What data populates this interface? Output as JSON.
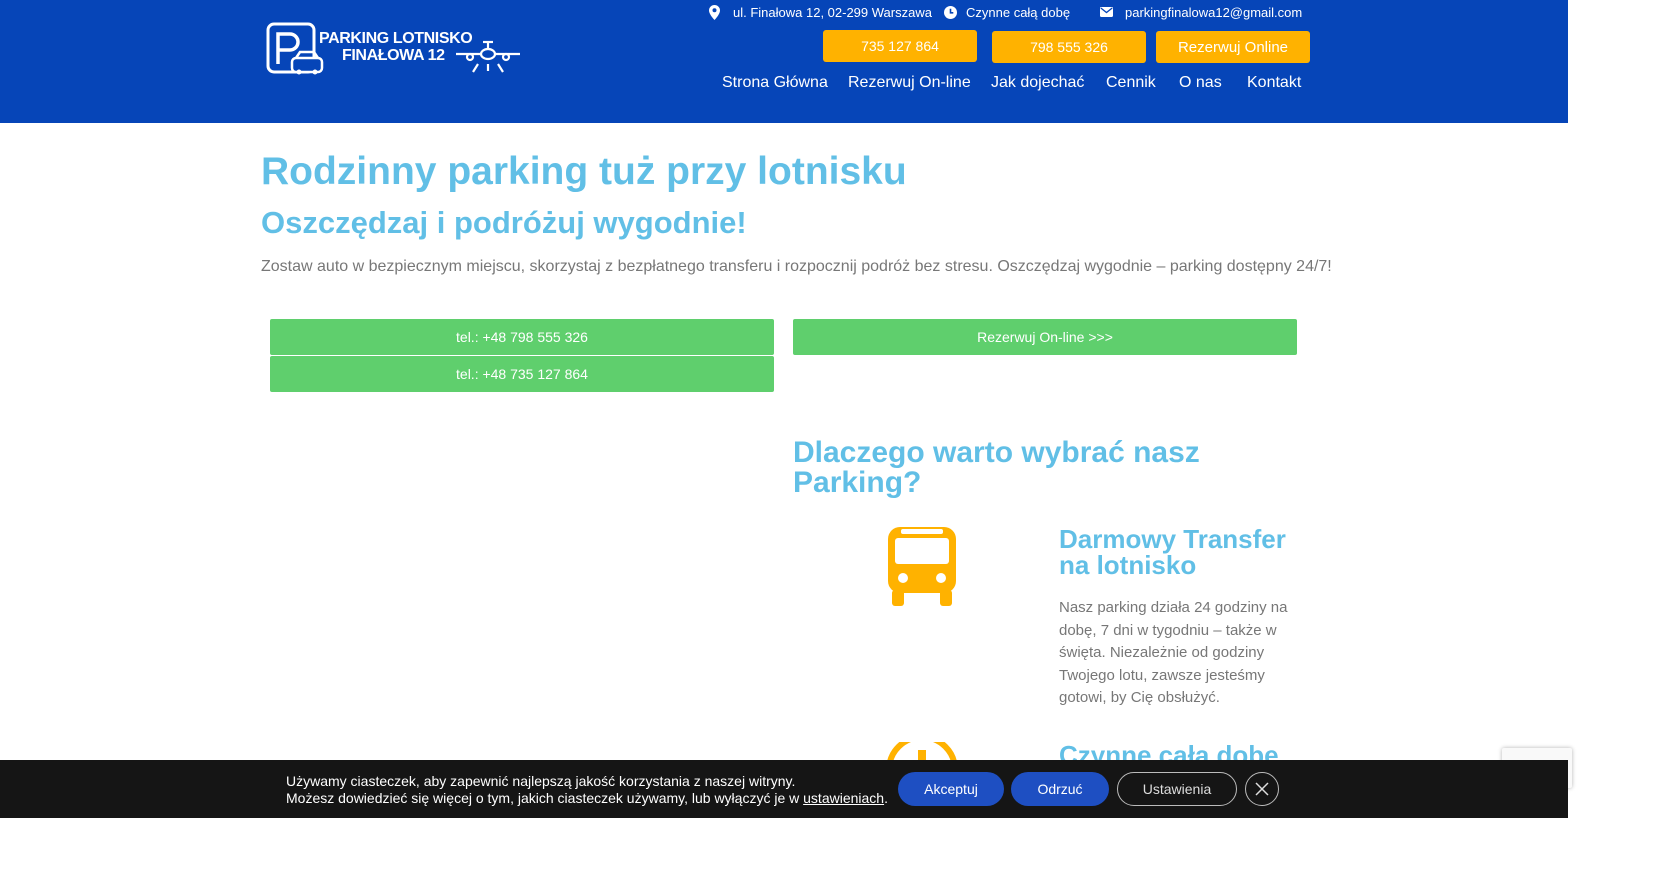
{
  "header": {
    "logo": {
      "line1": "PARKING LOTNISKO",
      "line2": "FINAŁOWA 12"
    },
    "address": "ul. Finałowa 12, 02-299 Warszawa",
    "hours": "Czynne całą dobę",
    "email": "parkingfinalowa12@gmail.com",
    "phone1_button": "735 127 864",
    "phone2_button": "798 555 326",
    "reserve_button": "Rezerwuj Online",
    "nav": [
      "Strona Główna",
      "Rezerwuj On-line",
      "Jak dojechać",
      "Cennik",
      "O nas",
      "Kontakt"
    ]
  },
  "hero": {
    "title": "Rodzinny parking tuż przy lotnisku",
    "subtitle": "Oszczędzaj i podróżuj wygodnie!",
    "lead": "Zostaw auto w bezpiecznym miejscu, skorzystaj z bezpłatnego transferu i rozpocznij podróż bez stresu. Oszczędzaj wygodnie – parking dostępny 24/7!",
    "call1": "tel.: +48 798 555 326",
    "call2": "tel.: +48 735 127 864",
    "reserve": "Rezerwuj On-line >>>"
  },
  "why": {
    "title": "Dlaczego warto wybrać nasz Parking?",
    "features": [
      {
        "icon": "bus-icon",
        "title": "Darmowy Transfer na lotnisko",
        "text": "Nasz parking działa 24 godziny na dobę, 7 dni w tygodniu – także w święta. Niezależnie od godziny Twojego lotu, zawsze jesteśmy gotowi, by Cię obsłużyć."
      },
      {
        "icon": "clock-icon",
        "title": "Czynne całą dobę"
      }
    ]
  },
  "cookie": {
    "line1": "Używamy ciasteczek, aby zapewnić najlepszą jakość korzystania z naszej witryny.",
    "line2": "Możesz dowiedzieć się więcej o tym, jakich ciasteczek używamy, lub wyłączyć je w",
    "link": "ustawieniach",
    "period": ".",
    "accept": "Akceptuj",
    "reject": "Odrzuć",
    "settings": "Ustawienia"
  },
  "colors": {
    "header_bg": "#0645b8",
    "accent_orange": "#ffb200",
    "heading_blue": "#61bfe6",
    "green_button": "#5fcf6d",
    "cookie_bg": "#151515",
    "cookie_button": "#1e4fc2"
  }
}
